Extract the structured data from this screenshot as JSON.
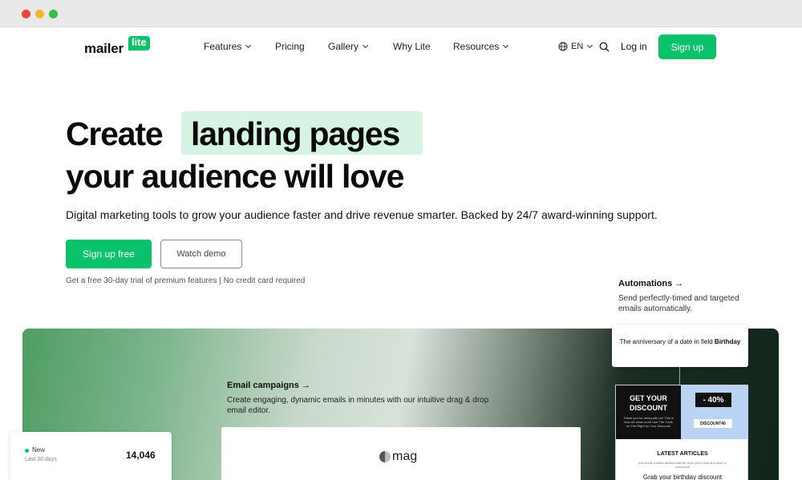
{
  "nav": {
    "logo_word": "mailer",
    "logo_badge": "lite",
    "items": [
      {
        "label": "Features",
        "dropdown": true
      },
      {
        "label": "Pricing",
        "dropdown": false
      },
      {
        "label": "Gallery",
        "dropdown": true
      },
      {
        "label": "Why Lite",
        "dropdown": false
      },
      {
        "label": "Resources",
        "dropdown": true
      }
    ],
    "language": "EN",
    "login": "Log in",
    "signup": "Sign up"
  },
  "hero": {
    "title_part1": "Create",
    "title_highlight": "landing pages",
    "title_line2": "your audience will love",
    "subtitle": "Digital marketing tools to grow your audience faster and drive revenue smarter. Backed by 24/7 award-winning support.",
    "cta_primary": "Sign up free",
    "cta_secondary": "Watch demo",
    "trial_note": "Get a free 30-day trial of premium features | No credit card required"
  },
  "automations": {
    "title": "Automations →",
    "description": "Send perfectly-timed and targeted emails automatically.",
    "trigger_text": "The anniversary of a date in field",
    "trigger_field": "Birthday"
  },
  "email_campaigns": {
    "title": "Email campaigns →",
    "description": "Create engaging, dynamic emails in minutes with our intuitive drag & drop email editor.",
    "brand": "mag"
  },
  "stat": {
    "label": "New",
    "period": "Last 30 days",
    "value": "14,046"
  },
  "email_preview": {
    "discount_title": "GET YOUR DISCOUNT",
    "discount_small": "Thank you for being with us! This is how we show ours! Use The Code on The Right for Your Discount!",
    "percent": "- 40%",
    "code": "DISCOUNT40",
    "latest_title": "LATEST ARTICLES",
    "latest_sub": "We found curated articles that we think you'd love and want to read more",
    "grab": "Grab your birthday discount"
  },
  "colors": {
    "brand_green": "#09c269",
    "highlight": "#d6f4e3"
  }
}
